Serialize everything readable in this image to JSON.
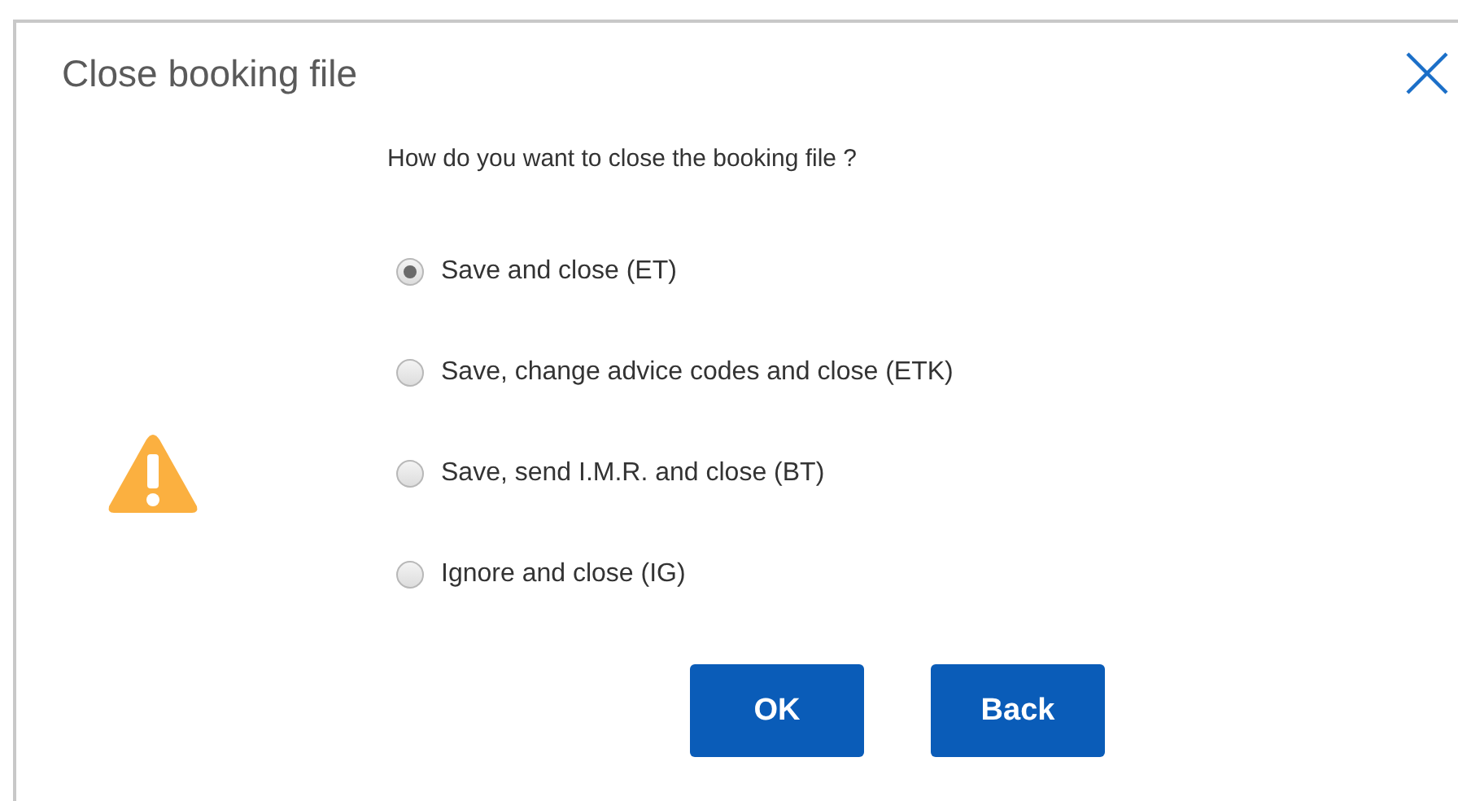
{
  "dialog": {
    "title": "Close booking file"
  },
  "question": "How do you want to close the booking file ?",
  "options": [
    {
      "label": "Save and close (ET)",
      "selected": true
    },
    {
      "label": "Save, change advice codes and close (ETK)",
      "selected": false
    },
    {
      "label": "Save, send I.M.R. and close (BT)",
      "selected": false
    },
    {
      "label": "Ignore and close (IG)",
      "selected": false
    }
  ],
  "buttons": [
    "OK",
    "Back"
  ]
}
